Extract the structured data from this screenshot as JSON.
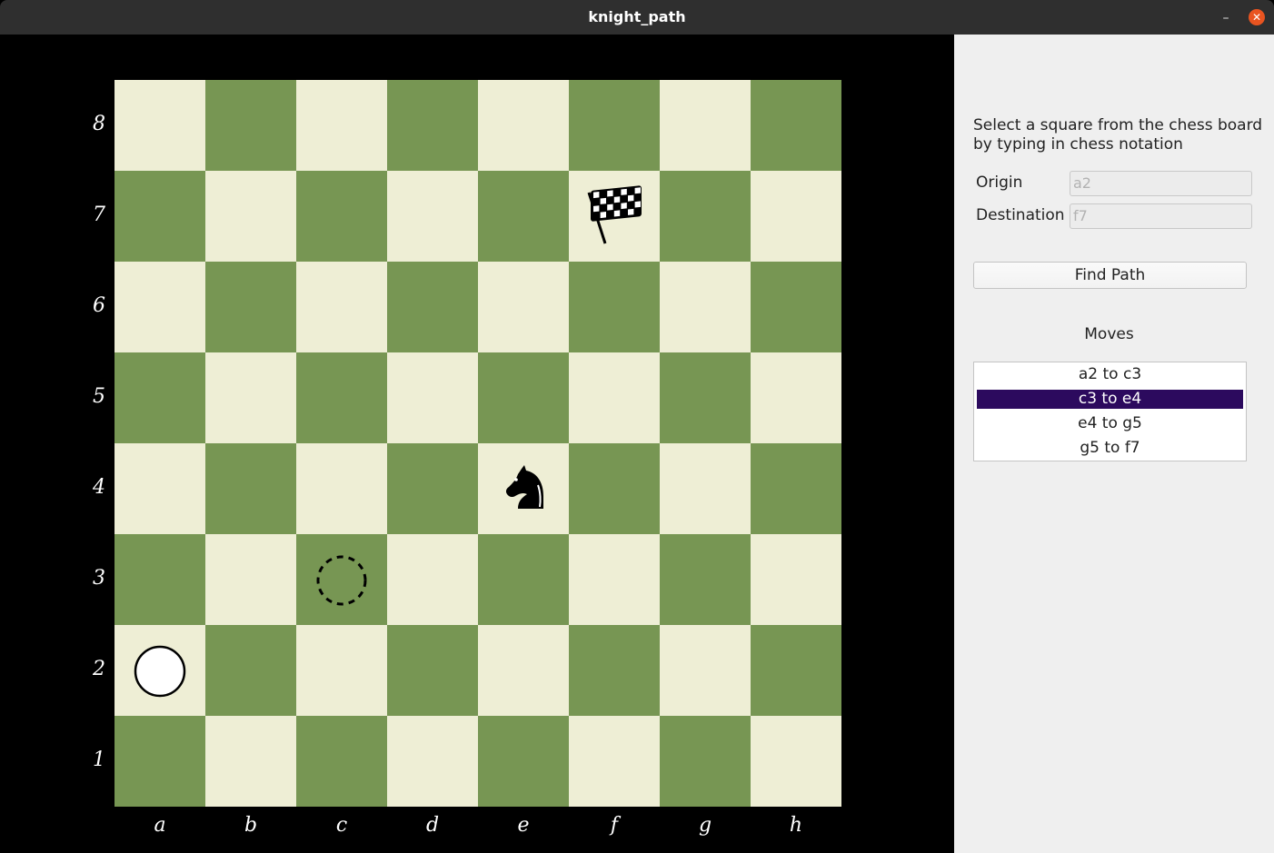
{
  "window": {
    "title": "knight_path",
    "minimize_glyph": "–",
    "close_glyph": "✕"
  },
  "board": {
    "files": [
      "a",
      "b",
      "c",
      "d",
      "e",
      "f",
      "g",
      "h"
    ],
    "ranks": [
      "8",
      "7",
      "6",
      "5",
      "4",
      "3",
      "2",
      "1"
    ],
    "light_color": "#eeeed5",
    "dark_color": "#779653",
    "origin_square": "a2",
    "visited_square": "c3",
    "knight_square": "e4",
    "destination_square": "f7",
    "origin_marker_icon": "white-circle-icon",
    "visited_marker_icon": "dashed-circle-icon",
    "knight_icon": "black-knight-icon",
    "destination_icon": "checkered-flag-icon"
  },
  "side": {
    "instructions": "Select a square from the chess board by typing in chess notation",
    "origin_label": "Origin",
    "origin_placeholder": "a2",
    "destination_label": "Destination",
    "destination_placeholder": "f7",
    "find_button": "Find Path",
    "moves_title": "Moves",
    "moves": [
      "a2 to c3",
      "c3 to e4",
      "e4 to g5",
      "g5 to f7"
    ],
    "selected_move_index": 1,
    "selection_color": "#2c0a5e"
  }
}
